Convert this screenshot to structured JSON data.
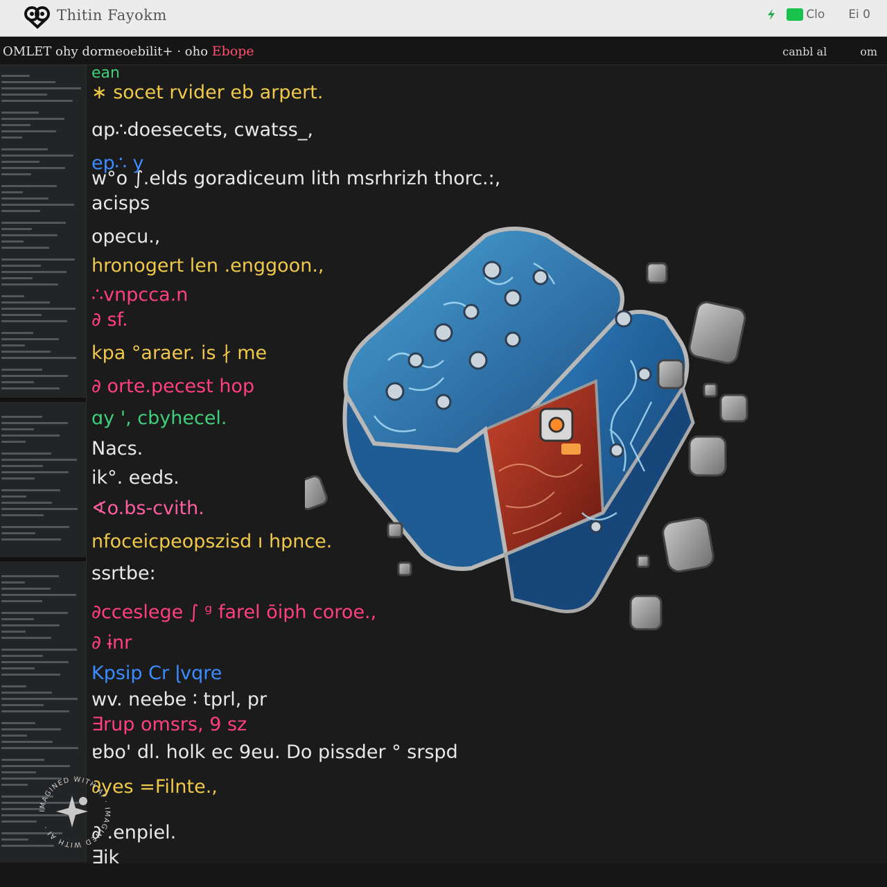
{
  "app": {
    "title": "Thitin Fayokm",
    "status_label": "Clo",
    "window_controls": "Ei 0"
  },
  "editor_header": {
    "path": "OMLET ohy dormeoebilit+ · oho",
    "accent": "Ebope",
    "right_a": "canbl al",
    "right_b": "om"
  },
  "code_lines": [
    {
      "t": "ean",
      "c": "#3fd07a"
    },
    {
      "t": "∗ socet  rvider  eb arpert.",
      "c": "#f0c94a"
    },
    {
      "t": "ɑp∴doesecets, cwatss_,",
      "c": "#e8e8e8"
    },
    {
      "t": "ep∴ y",
      "c": "#3b8cff"
    },
    {
      "t": "w°o  ∫.elds gorаdiᴄeum lith msrhrizh thorc.:,",
      "c": "#e8e8e8"
    },
    {
      "t": "aᴄisps",
      "c": "#e8e8e8"
    },
    {
      "t": "opecu.,",
      "c": "#e8e8e8"
    },
    {
      "t": "hronogert  len  .enggoon.,",
      "c": "#f0c94a"
    },
    {
      "t": "∴vnpcca.n",
      "c": "#ff3f7f"
    },
    {
      "t": "∂ sf.",
      "c": "#ff3f7f"
    },
    {
      "t": "kpa  °araer.  is  ∤ me",
      "c": "#f0c94a"
    },
    {
      "t": "∂  orte.pecest  hop",
      "c": "#ff3f7f"
    },
    {
      "t": "ɑy ',  cbyhecel.",
      "c": "#3fd07a"
    },
    {
      "t": "Nacs.",
      "c": "#e8e8e8"
    },
    {
      "t": "ik°.  eeds.",
      "c": "#e8e8e8"
    },
    {
      "t": "∢o.bs-cvith.",
      "c": "#ff5fa0"
    },
    {
      "t": "nfoceicpeopszisd  ı  hpnce.",
      "c": "#f0c94a"
    },
    {
      "t": "ssrtbe:",
      "c": "#e8e8e8"
    },
    {
      "t": "∂cceslege  ∫  ᵍ  farel  ōiph coroe.,",
      "c": "#ff3f7f"
    },
    {
      "t": "∂  ɨnr",
      "c": "#ff3f7f"
    },
    {
      "t": "Kpsip  Cr  ɭvqre",
      "c": "#3b8cff"
    },
    {
      "t": "wv.  neebe  ∶  tprl,  pr",
      "c": "#e8e8e8"
    },
    {
      "t": "∃rup  omsrs,  9  sz",
      "c": "#ff3f7f"
    },
    {
      "t": "ɐbo'  dl.  holk  ec  9eu.  Do  pissder °  srspd",
      "c": "#e8e8e8"
    },
    {
      "t": "∂yes  =Filnte.,",
      "c": "#f0c94a"
    },
    {
      "t": "∂  .enpiel.",
      "c": "#e8e8e8"
    },
    {
      "t": "∃ik",
      "c": "#e8e8e8"
    }
  ],
  "watermark": {
    "text": "IMAGINED WITH AI · IMAGINED WITH AI ·"
  }
}
